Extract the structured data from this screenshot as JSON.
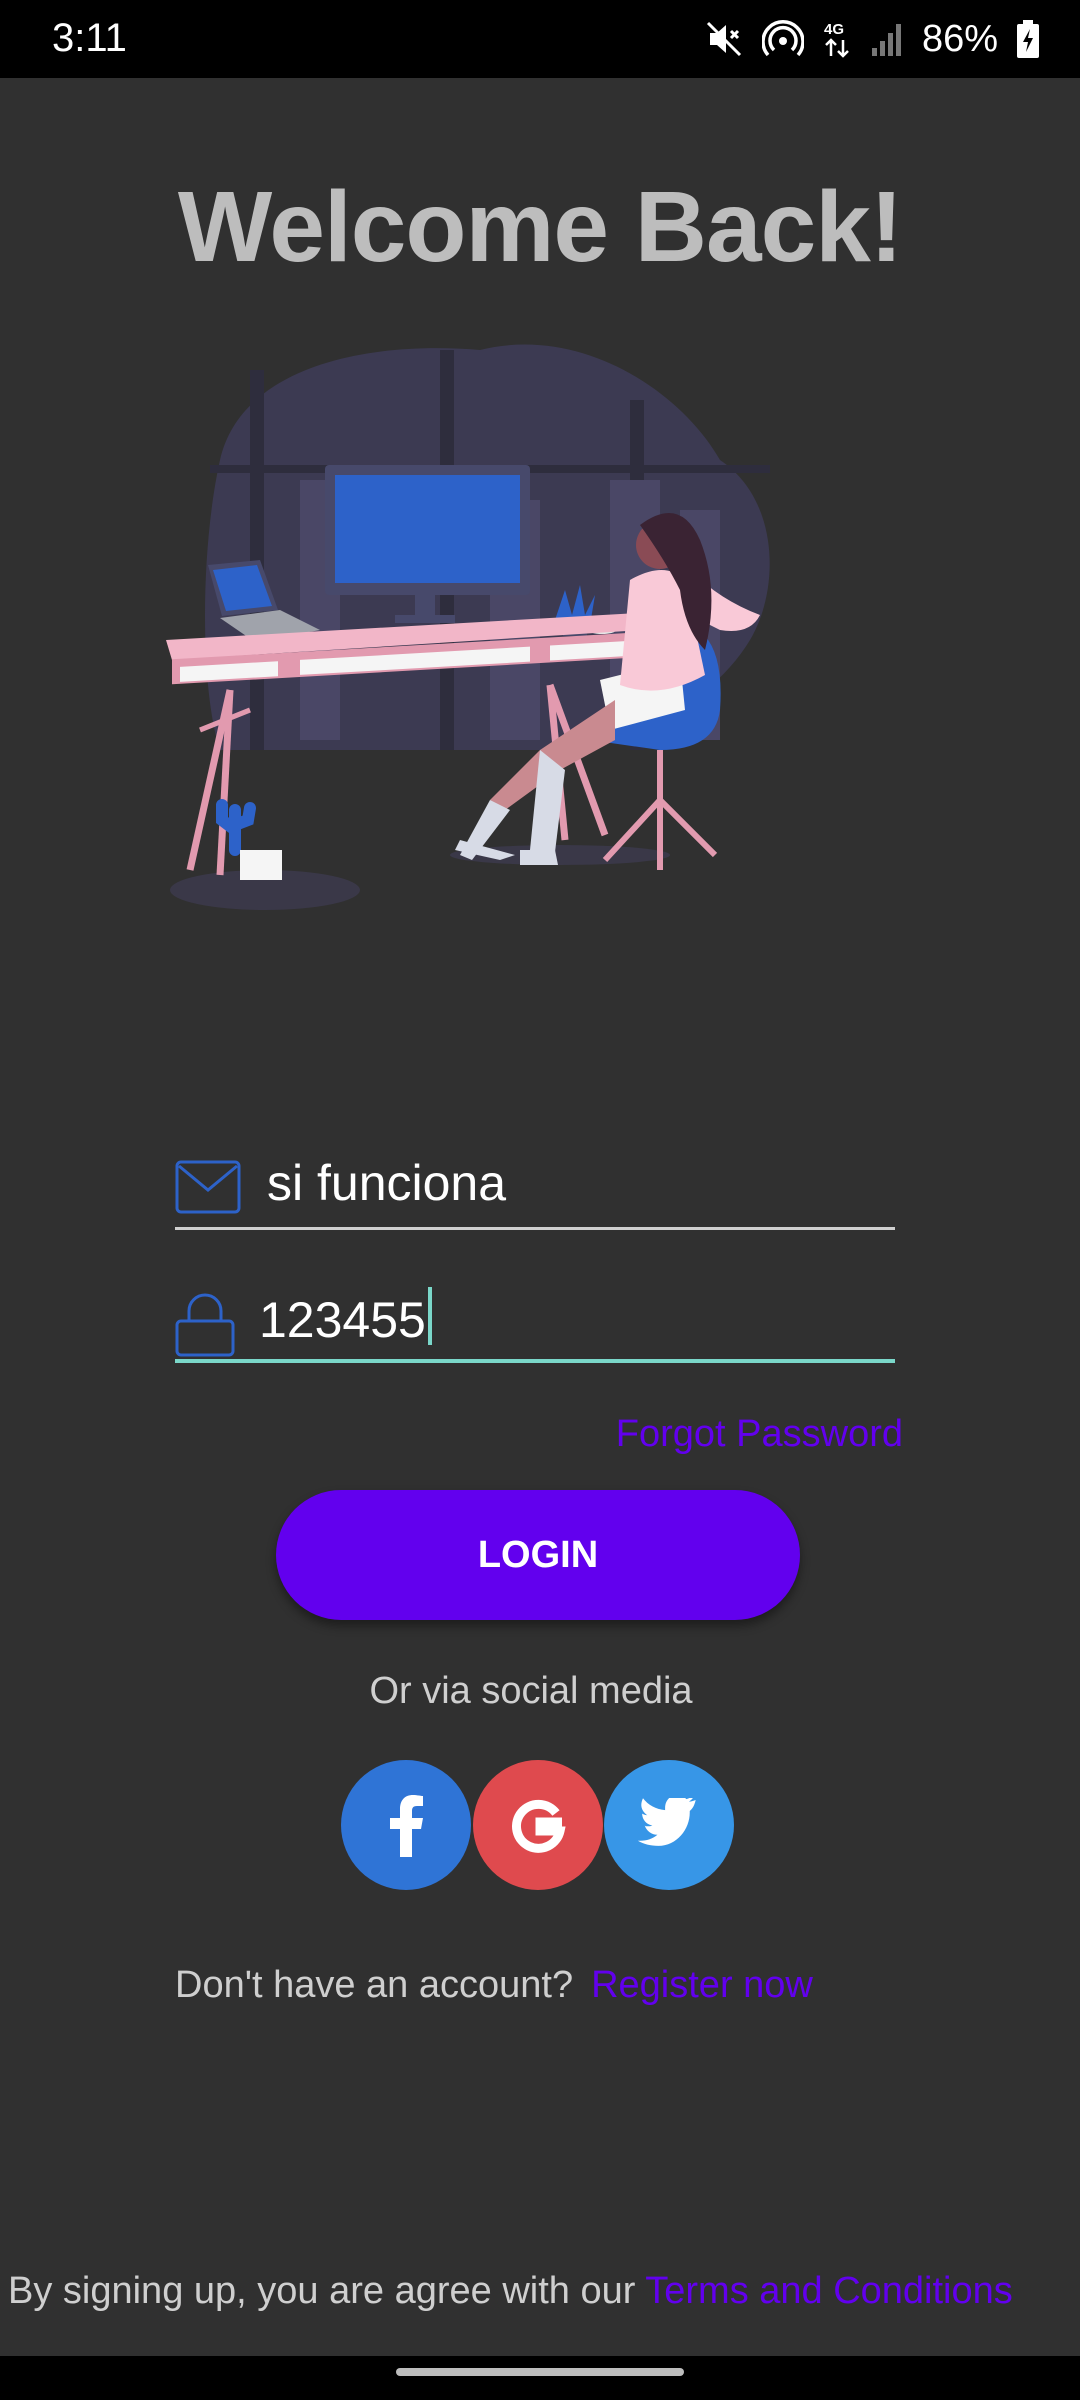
{
  "status_bar": {
    "time": "3:11",
    "battery": "86%",
    "icons": [
      "mute-icon",
      "hotspot-icon",
      "4g-icon",
      "signal-icon",
      "battery-charging-icon"
    ]
  },
  "title": "Welcome Back!",
  "illustration": {
    "icon": "workspace-illustration"
  },
  "email": {
    "value": "si funciona",
    "icon": "mail-icon"
  },
  "password": {
    "value": "123455",
    "icon": "lock-icon"
  },
  "forgot_password": "Forgot Password",
  "login_button": "LOGIN",
  "social": {
    "label": "Or via social media",
    "facebook_icon": "facebook-icon",
    "google_icon": "google-icon",
    "twitter_icon": "twitter-icon"
  },
  "register": {
    "prompt": "Don't have an account?",
    "link": "Register now"
  },
  "terms": {
    "prefix": "By signing up, you are agree with our",
    "link": "Terms and Conditions"
  },
  "colors": {
    "accent": "#6200ee",
    "background": "#303030",
    "focus_underline": "#7ad7c9"
  }
}
